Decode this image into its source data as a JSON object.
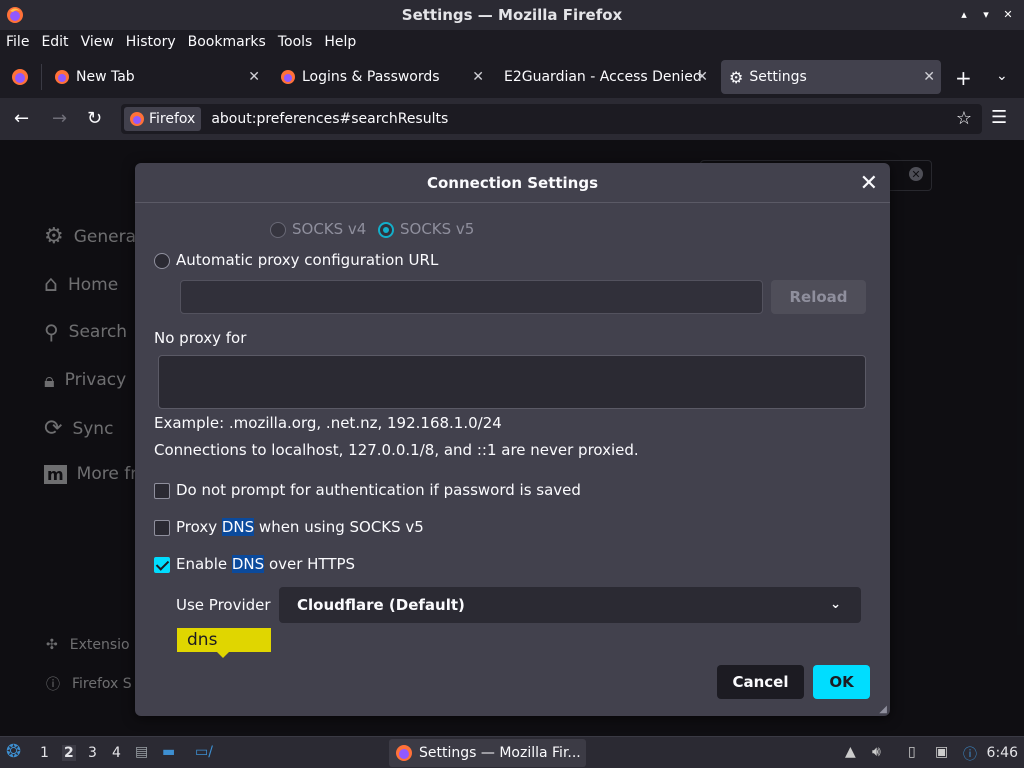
{
  "window": {
    "title": "Settings — Mozilla Firefox",
    "controls": [
      "▴",
      "▾",
      "✕"
    ]
  },
  "menu": [
    "File",
    "Edit",
    "View",
    "History",
    "Bookmarks",
    "Tools",
    "Help"
  ],
  "tabs": [
    {
      "label": "New Tab",
      "icon": "firefox-icon"
    },
    {
      "label": "Logins & Passwords",
      "icon": "firefox-icon"
    },
    {
      "label": "E2Guardian - Access Denied",
      "icon": ""
    },
    {
      "label": "Settings",
      "icon": "gear-icon",
      "active": true
    }
  ],
  "nav": {
    "identity_label": "Firefox",
    "url": "about:preferences#searchResults"
  },
  "sidebar": {
    "items": [
      {
        "label": "General",
        "icon": "gear-icon"
      },
      {
        "label": "Home",
        "icon": "home-icon"
      },
      {
        "label": "Search",
        "icon": "search-icon"
      },
      {
        "label": "Privacy",
        "icon": "lock-icon"
      },
      {
        "label": "Sync",
        "icon": "sync-icon"
      },
      {
        "label": "More fr",
        "icon": "mozilla-icon"
      }
    ],
    "footer": [
      {
        "label": "Extensio",
        "icon": "puzzle-icon"
      },
      {
        "label": "Firefox S",
        "icon": "help-icon"
      }
    ]
  },
  "dialog": {
    "title": "Connection Settings",
    "socks_v4": "SOCKS v4",
    "socks_v5": "SOCKS v5",
    "auto_proxy_label": "Automatic proxy configuration URL",
    "auto_proxy_value": "",
    "reload_label": "Reload",
    "no_proxy_label": "No proxy for",
    "no_proxy_value": "",
    "example_text": "Example: .mozilla.org, .net.nz, 192.168.1.0/24",
    "localhost_text": "Connections to localhost, 127.0.0.1/8, and ::1 are never proxied.",
    "no_prompt_label": "Do not prompt for authentication if password is saved",
    "proxy_dns_pre": "Proxy ",
    "proxy_dns_hl": "DNS",
    "proxy_dns_post": " when using SOCKS v5",
    "enable_doh_pre": "Enable ",
    "enable_doh_hl": "DNS",
    "enable_doh_post": " over HTTPS",
    "use_provider_label": "Use Provider",
    "provider_value": "Cloudflare (Default)",
    "tooltip": "dns",
    "cancel_label": "Cancel",
    "ok_label": "OK"
  },
  "taskbar": {
    "workspaces": [
      "1",
      "2",
      "3",
      "4"
    ],
    "task_label": "Settings — Mozilla Fir...",
    "clock": "6:46"
  },
  "colors": {
    "accent": "#00ddff",
    "highlight": "#0b4a9c",
    "tooltip": "#e0d600",
    "dialog_bg": "#42414d"
  }
}
